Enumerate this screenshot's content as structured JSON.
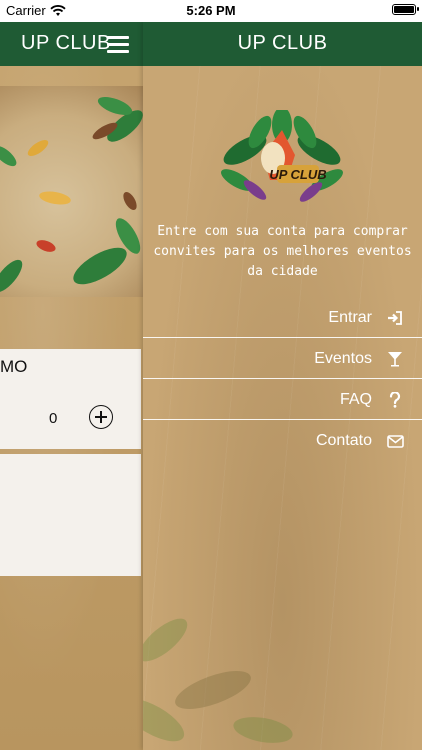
{
  "status_bar": {
    "carrier": "Carrier",
    "time": "5:26 PM",
    "icons": [
      "wifi-icon",
      "battery-icon"
    ]
  },
  "main": {
    "title": "UP CLUB",
    "event": {
      "name_fragment": "MO",
      "quantity": "0"
    }
  },
  "drawer": {
    "title": "UP CLUB",
    "tagline": "Entre com sua conta para comprar convites para os melhores eventos da cidade",
    "logo_text": "UP CLUB",
    "menu": [
      {
        "label": "Entrar",
        "icon": "login-icon"
      },
      {
        "label": "Eventos",
        "icon": "cocktail-icon"
      },
      {
        "label": "FAQ",
        "icon": "question-icon"
      },
      {
        "label": "Contato",
        "icon": "envelope-icon"
      }
    ]
  },
  "colors": {
    "header_green": "#1f5b34",
    "drawer_bg": "#c8a674",
    "text_white": "#ffffff"
  }
}
